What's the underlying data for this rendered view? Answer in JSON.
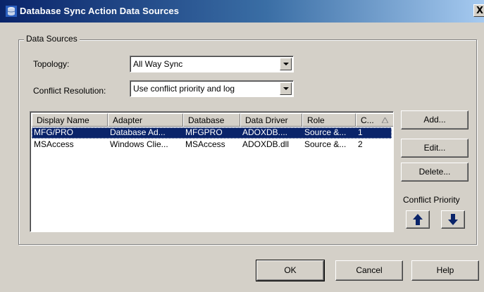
{
  "window": {
    "title": "Database Sync Action Data Sources",
    "close_label": "X"
  },
  "group": {
    "legend": "Data Sources"
  },
  "topology": {
    "label": "Topology:",
    "value": "All Way Sync"
  },
  "conflict_resolution": {
    "label": "Conflict Resolution:",
    "value": "Use conflict priority and log"
  },
  "table": {
    "columns": [
      "Display Name",
      "Adapter",
      "Database",
      "Data Driver",
      "Role",
      "C..."
    ],
    "rows": [
      {
        "cells": [
          "MFG/PRO",
          "Database Ad...",
          "MFGPRO",
          "ADOXDB....",
          "Source &...",
          "1"
        ],
        "selected": true
      },
      {
        "cells": [
          "MSAccess",
          "Windows Clie...",
          "MSAccess",
          "ADOXDB.dll",
          "Source &...",
          "2"
        ],
        "selected": false
      }
    ]
  },
  "side_buttons": {
    "add": "Add...",
    "edit": "Edit...",
    "delete": "Delete..."
  },
  "conflict_priority": {
    "label": "Conflict Priority",
    "up_icon": "arrow-up-icon",
    "down_icon": "arrow-down-icon",
    "arrow_color": "#0a246a"
  },
  "footer_buttons": {
    "ok": "OK",
    "cancel": "Cancel",
    "help": "Help"
  },
  "colors": {
    "selection": "#0a246a",
    "face": "#d4d0c8"
  }
}
